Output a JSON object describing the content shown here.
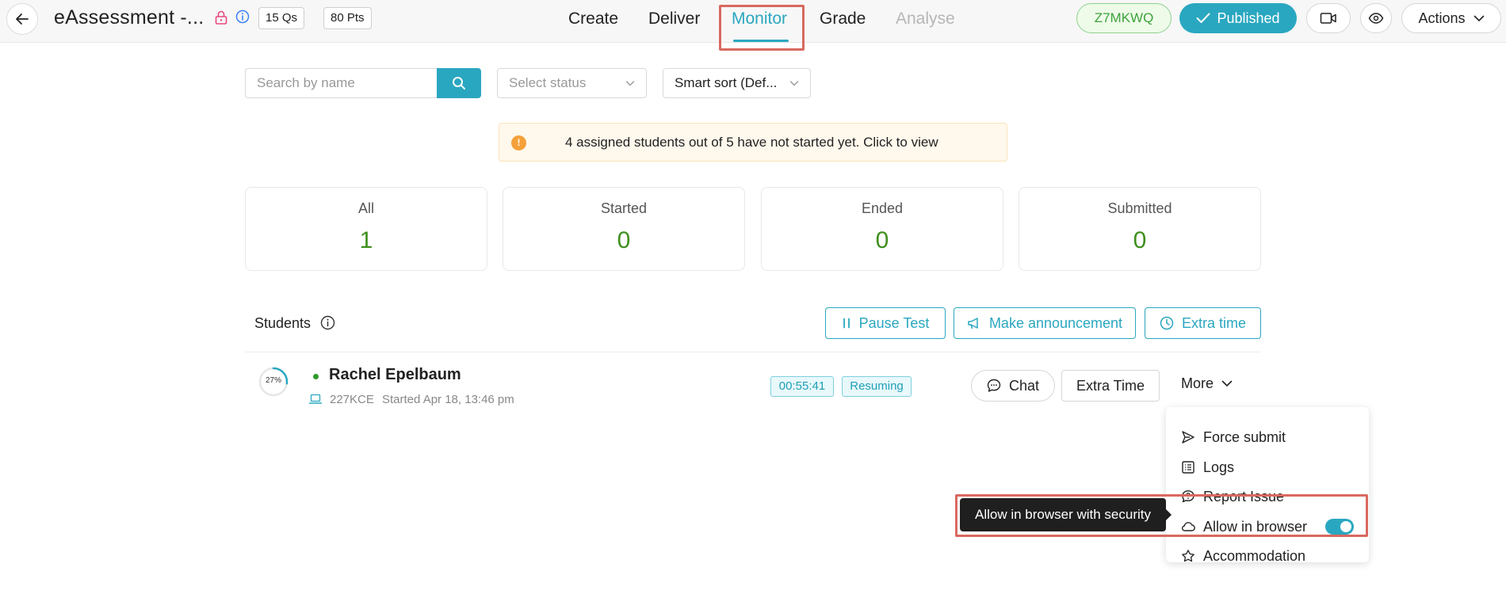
{
  "header": {
    "title": "eAssessment -...",
    "questions": "15 Qs",
    "points": "80 Pts",
    "nav": {
      "create": "Create",
      "deliver": "Deliver",
      "monitor": "Monitor",
      "grade": "Grade",
      "analyse": "Analyse"
    },
    "access_code": "Z7MKWQ",
    "published_label": "Published",
    "actions_label": "Actions"
  },
  "filters": {
    "search_placeholder": "Search by name",
    "status_placeholder": "Select status",
    "sort_label": "Smart sort (Def..."
  },
  "notice": {
    "text": "4 assigned students out of 5 have not started yet. Click to view"
  },
  "stats": [
    {
      "label": "All",
      "value": "1"
    },
    {
      "label": "Started",
      "value": "0"
    },
    {
      "label": "Ended",
      "value": "0"
    },
    {
      "label": "Submitted",
      "value": "0"
    }
  ],
  "students_section": {
    "title": "Students",
    "pause_label": "Pause Test",
    "announce_label": "Make announcement",
    "extra_time_label": "Extra time"
  },
  "student": {
    "progress": "27%",
    "progress_fraction": 0.27,
    "name": "Rachel Epelbaum",
    "code": "227KCE",
    "started": "Started Apr 18, 13:46 pm",
    "timer": "00:55:41",
    "status": "Resuming",
    "chat_label": "Chat",
    "extra_time_label": "Extra Time",
    "more_label": "More"
  },
  "menu": {
    "force_submit": "Force submit",
    "logs": "Logs",
    "report_issue": "Report Issue",
    "allow_in_browser": "Allow in browser",
    "accommodation": "Accommodation"
  },
  "tooltip": {
    "text": "Allow in browser with security"
  },
  "colors": {
    "accent": "#2aa7c0",
    "success": "#3e8f1e",
    "highlight": "#d9695f"
  }
}
